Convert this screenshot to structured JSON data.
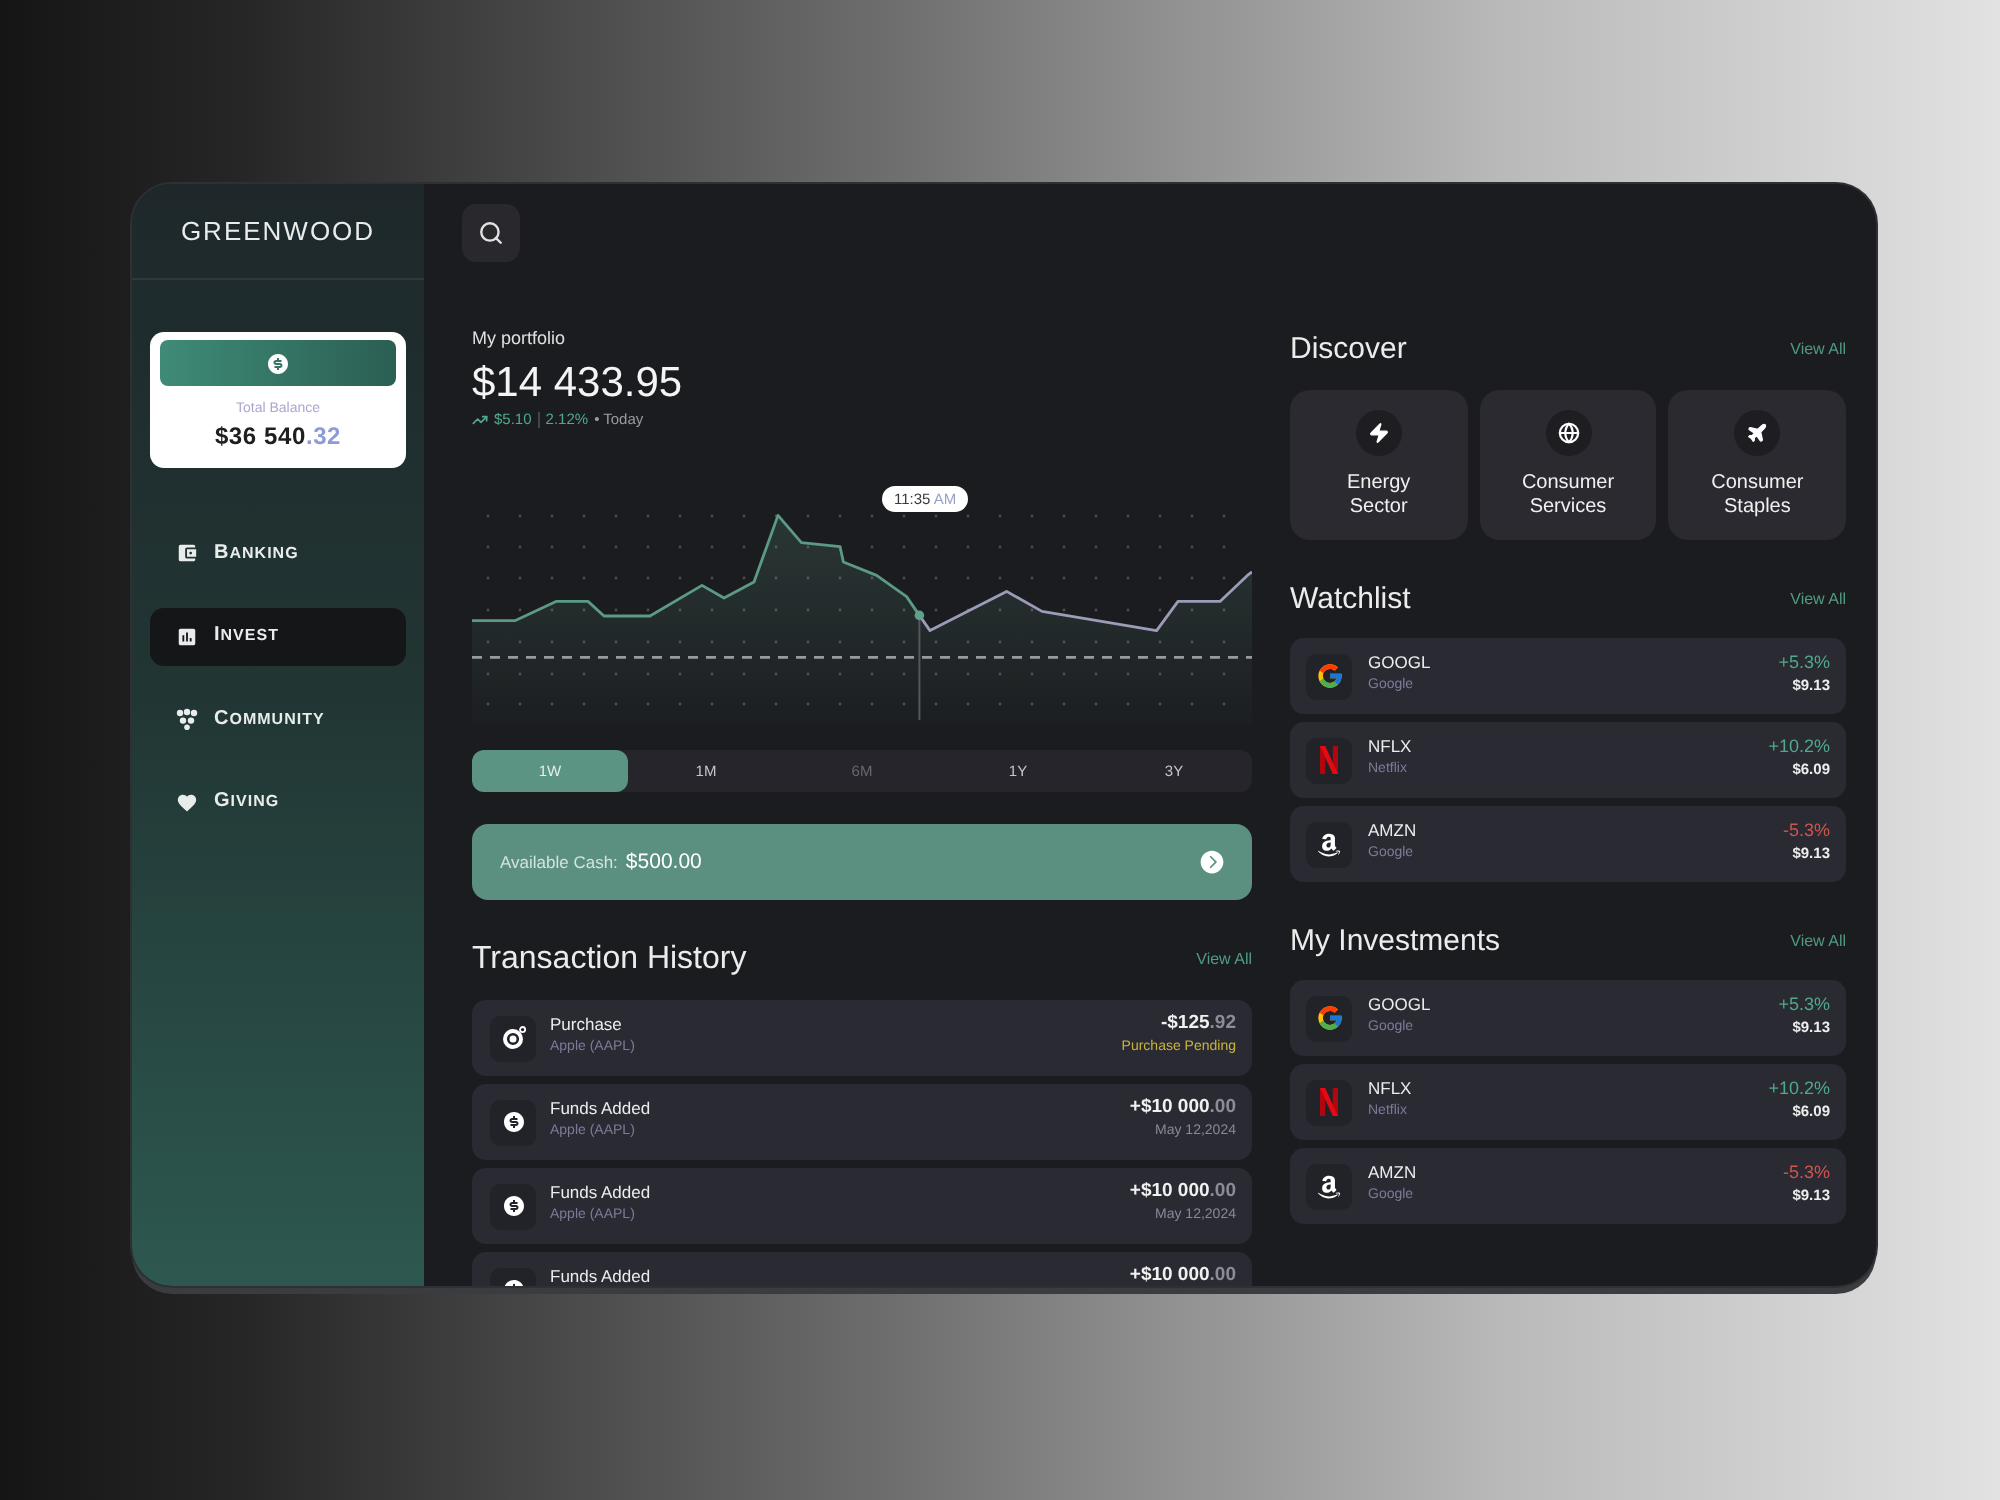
{
  "sidebar": {
    "logo": "GREENWOOD",
    "balance": {
      "label": "Total Balance",
      "amount": "$36 540",
      "cents": ".32"
    },
    "nav": [
      {
        "label": "BANKING",
        "selected": false
      },
      {
        "label": "INVEST",
        "selected": true
      },
      {
        "label": "COMMUNITY",
        "selected": false
      },
      {
        "label": "GIVING",
        "selected": false
      }
    ]
  },
  "portfolio": {
    "label": "My portfolio",
    "value": "$14 433.95",
    "change": "$5.10",
    "percent": "2.12%",
    "period": "• Today",
    "tooltip": {
      "time": "11:35",
      "meridiem": "AM"
    }
  },
  "ranges": [
    {
      "label": "1W",
      "selected": true,
      "disabled": false
    },
    {
      "label": "1M",
      "selected": false,
      "disabled": false
    },
    {
      "label": "6M",
      "selected": false,
      "disabled": true
    },
    {
      "label": "1Y",
      "selected": false,
      "disabled": false
    },
    {
      "label": "3Y",
      "selected": false,
      "disabled": false
    }
  ],
  "cash": {
    "label": "Available Cash:",
    "amount": "$500.00"
  },
  "transactions": {
    "title": "Transaction History",
    "link": "View All",
    "rows": [
      {
        "kind": "purchase",
        "title": "Purchase",
        "subtitle": "Apple (AAPL)",
        "amount": "-$125",
        "cents": ".92",
        "note": "Purchase Pending"
      },
      {
        "kind": "deposit",
        "title": "Funds Added",
        "subtitle": "Apple (AAPL)",
        "amount": "+$10 000",
        "cents": ".00",
        "note": "May 12,2024"
      },
      {
        "kind": "deposit",
        "title": "Funds Added",
        "subtitle": "Apple (AAPL)",
        "amount": "+$10 000",
        "cents": ".00",
        "note": "May 12,2024"
      },
      {
        "kind": "deposit",
        "title": "Funds Added",
        "amount": "+$10 000",
        "cents": ".00"
      }
    ]
  },
  "discover": {
    "title": "Discover",
    "link": "View All",
    "items": [
      {
        "label": "Energy Sector"
      },
      {
        "label": "Consumer Services"
      },
      {
        "label": "Consumer Staples"
      }
    ]
  },
  "watchlist": {
    "title": "Watchlist",
    "link": "View All",
    "rows": [
      {
        "ticker": "GOOGL",
        "name": "Google",
        "change": "+5.3%",
        "negative": false,
        "price": "$9.13"
      },
      {
        "ticker": "NFLX",
        "name": "Netflix",
        "change": "+10.2%",
        "negative": false,
        "price": "$6.09"
      },
      {
        "ticker": "AMZN",
        "name": "Google",
        "change": "-5.3%",
        "negative": true,
        "price": "$9.13"
      }
    ]
  },
  "investments": {
    "title": "My Investments",
    "link": "View All",
    "rows": [
      {
        "ticker": "GOOGL",
        "name": "Google",
        "change": "+5.3%",
        "negative": false,
        "price": "$9.13"
      },
      {
        "ticker": "NFLX",
        "name": "Netflix",
        "change": "+10.2%",
        "negative": false,
        "price": "$6.09"
      },
      {
        "ticker": "AMZN",
        "name": "Google",
        "change": "-5.3%",
        "negative": true,
        "price": "$9.13"
      }
    ]
  }
}
